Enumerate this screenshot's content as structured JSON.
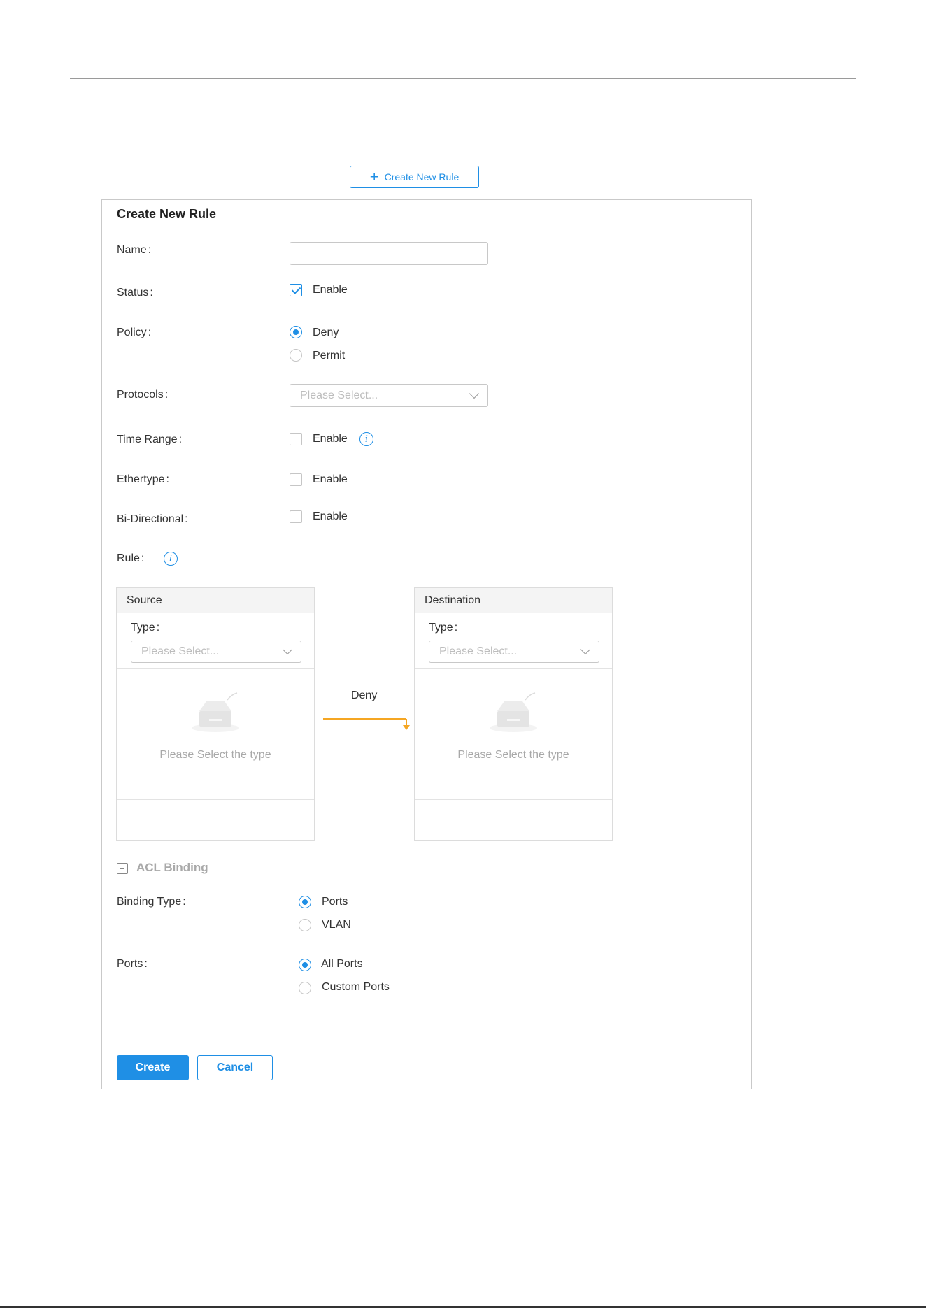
{
  "toolbar": {
    "create_new_rule_label": "Create New Rule"
  },
  "panel": {
    "title": "Create New Rule"
  },
  "form": {
    "name": {
      "label": "Name",
      "value": "",
      "placeholder": ""
    },
    "status": {
      "label": "Status",
      "option": "Enable",
      "checked": true
    },
    "policy": {
      "label": "Policy",
      "options": [
        "Deny",
        "Permit"
      ],
      "selected": "Deny"
    },
    "protocols": {
      "label": "Protocols",
      "placeholder": "Please Select..."
    },
    "time_range": {
      "label": "Time Range",
      "option": "Enable",
      "checked": false
    },
    "ethertype": {
      "label": "Ethertype",
      "option": "Enable",
      "checked": false
    },
    "bi_directional": {
      "label": "Bi-Directional",
      "option": "Enable",
      "checked": false
    },
    "rule": {
      "label": "Rule"
    }
  },
  "colon": ":",
  "rule_diagram": {
    "source": {
      "header": "Source",
      "type_label": "Type",
      "type_placeholder": "Please Select...",
      "empty_text": "Please Select the type"
    },
    "destination": {
      "header": "Destination",
      "type_label": "Type",
      "type_placeholder": "Please Select...",
      "empty_text": "Please Select the type"
    },
    "action_label": "Deny"
  },
  "acl_binding": {
    "title": "ACL Binding",
    "binding_type": {
      "label": "Binding Type",
      "options": [
        "Ports",
        "VLAN"
      ],
      "selected": "Ports"
    },
    "ports": {
      "label": "Ports",
      "options": [
        "All Ports",
        "Custom Ports"
      ],
      "selected": "All Ports"
    }
  },
  "actions": {
    "create_label": "Create",
    "cancel_label": "Cancel"
  },
  "colors": {
    "accent": "#1f8fe5",
    "arrow": "#f5a623",
    "muted_text": "#a8a8a8"
  },
  "icons": {
    "plus": "plus-icon",
    "info": "info-icon",
    "check": "check-icon",
    "empty": "empty-box-icon",
    "collapse": "minus-square-icon"
  }
}
